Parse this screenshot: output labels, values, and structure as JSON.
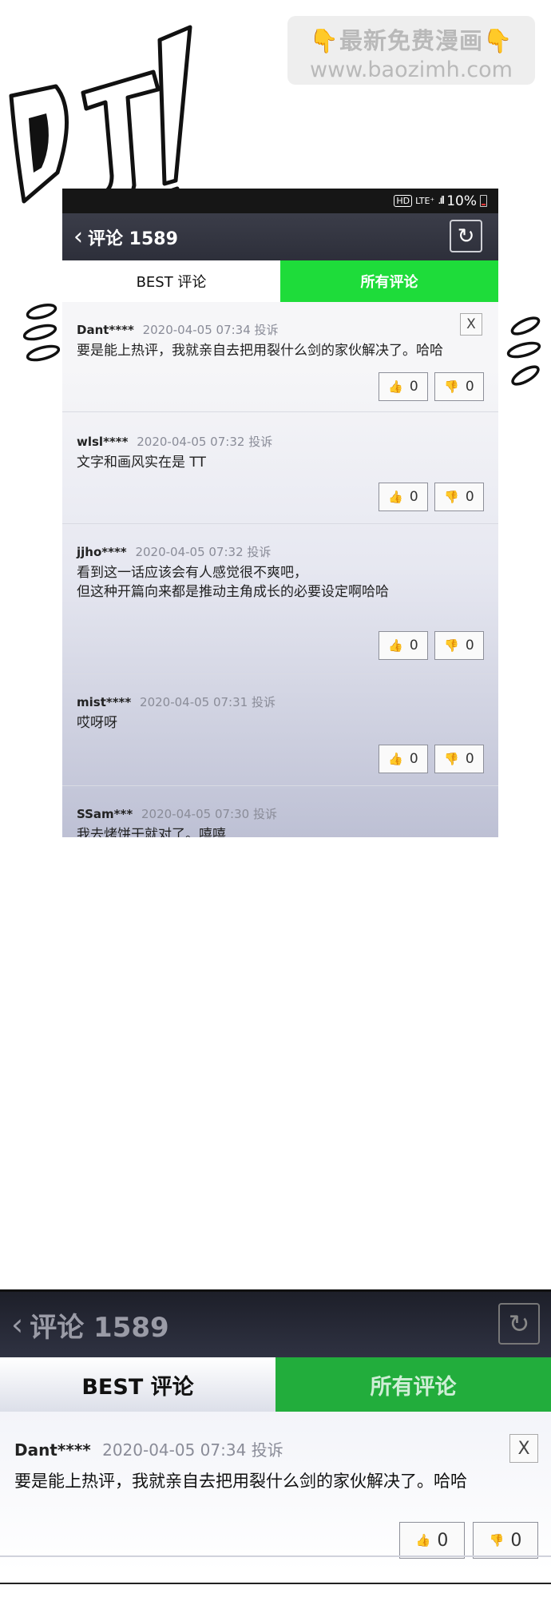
{
  "watermark": {
    "line1": "👇最新免费漫画👇",
    "line2": "www.baozimh.com"
  },
  "sound_effect": "叮!",
  "phone": {
    "status": {
      "hd": "HD",
      "network": "LTE⁺",
      "signal": ".ıll",
      "battery": "10%"
    },
    "header": {
      "title": "评论 1589"
    },
    "tabs": [
      {
        "label": "BEST 评论",
        "active": false
      },
      {
        "label": "所有评论",
        "active": true
      }
    ],
    "comments": [
      {
        "user": "Dant****",
        "time": "2020-04-05 07:34",
        "report": "投诉",
        "text": "要是能上热评，我就亲自去把用裂什么剑的家伙解决了。哈哈",
        "likes": "0",
        "dislikes": "0",
        "close": "X"
      },
      {
        "user": "wlsl****",
        "time": "2020-04-05 07:32",
        "report": "投诉",
        "text": "文字和画风实在是 TT",
        "likes": "0",
        "dislikes": "0"
      },
      {
        "user": "jjho****",
        "time": "2020-04-05 07:32",
        "report": "投诉",
        "text": "看到这一话应该会有人感觉很不爽吧，\n但这种开篇向来都是推动主角成长的必要设定啊哈哈",
        "likes": "0",
        "dislikes": "0"
      },
      {
        "user": "mist****",
        "time": "2020-04-05 07:31",
        "report": "投诉",
        "text": "哎呀呀",
        "likes": "0",
        "dislikes": "0"
      },
      {
        "user": "SSam***",
        "time": "2020-04-05 07:30",
        "report": "投诉",
        "text": "我去烤饼干就对了。嘻嘻",
        "likes": "",
        "dislikes": ""
      }
    ]
  },
  "zoom": {
    "header": {
      "title": "评论 1589"
    },
    "tabs": [
      {
        "label": "BEST 评论"
      },
      {
        "label": "所有评论"
      }
    ],
    "comment": {
      "user": "Dant****",
      "time": "2020-04-05 07:34",
      "report": "投诉",
      "text": "要是能上热评，我就亲自去把用裂什么剑的家伙解决了。哈哈",
      "likes": "0",
      "dislikes": "0",
      "close": "X"
    }
  },
  "colors": {
    "green_tab": "#1edc3a",
    "header_dark": "#2d2f3a",
    "like": "#e04a5c",
    "dislike": "#1e90d8"
  },
  "icons": {
    "back": "chevron-left-icon",
    "refresh": "refresh-icon",
    "like": "thumbs-up-icon",
    "dislike": "thumbs-down-icon"
  }
}
